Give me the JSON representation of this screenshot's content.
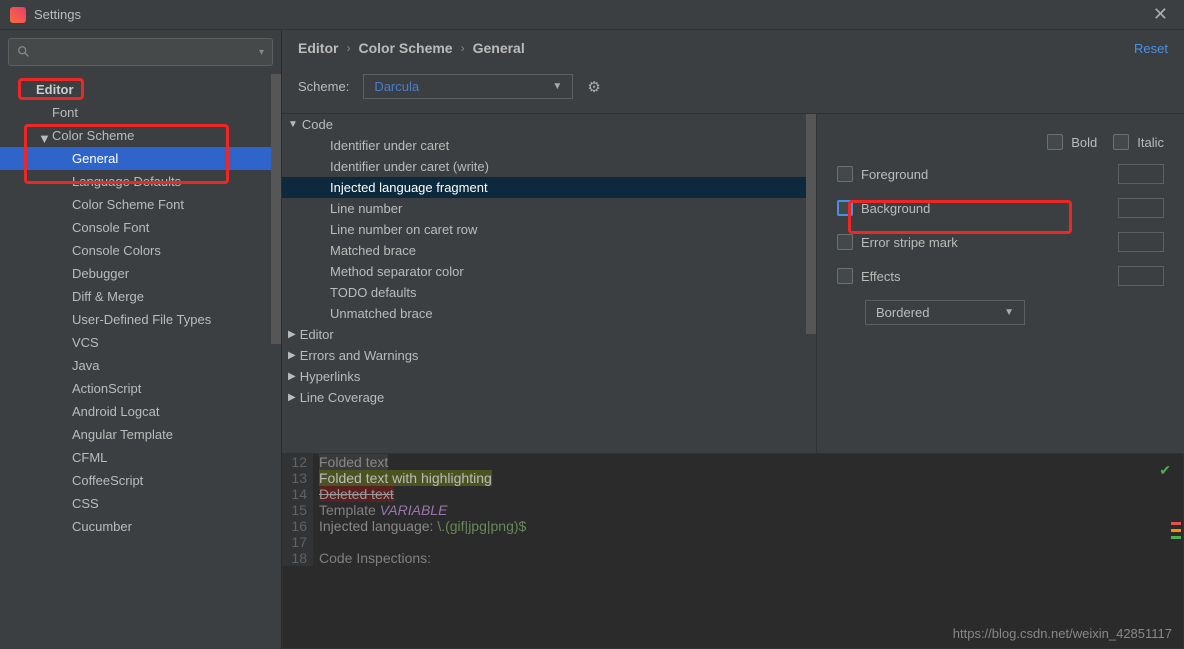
{
  "titlebar": {
    "title": "Settings",
    "search_placeholder": ""
  },
  "sidebar": {
    "editor_label": "Editor",
    "items": [
      {
        "label": "Font",
        "level": "l1"
      },
      {
        "label": "Color Scheme",
        "level": "l1",
        "expandable": true
      },
      {
        "label": "General",
        "level": "l2",
        "selected": true
      },
      {
        "label": "Language Defaults",
        "level": "l2"
      },
      {
        "label": "Color Scheme Font",
        "level": "l2"
      },
      {
        "label": "Console Font",
        "level": "l2"
      },
      {
        "label": "Console Colors",
        "level": "l2"
      },
      {
        "label": "Debugger",
        "level": "l2"
      },
      {
        "label": "Diff & Merge",
        "level": "l2"
      },
      {
        "label": "User-Defined File Types",
        "level": "l2"
      },
      {
        "label": "VCS",
        "level": "l2"
      },
      {
        "label": "Java",
        "level": "l2"
      },
      {
        "label": "ActionScript",
        "level": "l2"
      },
      {
        "label": "Android Logcat",
        "level": "l2"
      },
      {
        "label": "Angular Template",
        "level": "l2"
      },
      {
        "label": "CFML",
        "level": "l2"
      },
      {
        "label": "CoffeeScript",
        "level": "l2"
      },
      {
        "label": "CSS",
        "level": "l2"
      },
      {
        "label": "Cucumber",
        "level": "l2"
      }
    ]
  },
  "breadcrumb": {
    "a": "Editor",
    "b": "Color Scheme",
    "c": "General",
    "reset": "Reset"
  },
  "scheme": {
    "label": "Scheme:",
    "value": "Darcula"
  },
  "categories": {
    "code_label": "Code",
    "items": [
      "Identifier under caret",
      "Identifier under caret (write)",
      "Injected language fragment",
      "Line number",
      "Line number on caret row",
      "Matched brace",
      "Method separator color",
      "TODO defaults",
      "Unmatched brace"
    ],
    "groups": [
      "Editor",
      "Errors and Warnings",
      "Hyperlinks",
      "Line Coverage"
    ]
  },
  "props": {
    "bold": "Bold",
    "italic": "Italic",
    "foreground": "Foreground",
    "background": "Background",
    "error_stripe": "Error stripe mark",
    "effects": "Effects",
    "effects_value": "Bordered"
  },
  "preview": {
    "lines": [
      {
        "n": "12",
        "text": "Folded text",
        "cls": "folded"
      },
      {
        "n": "13",
        "text": "Folded text with highlighting",
        "cls": "folded-hl"
      },
      {
        "n": "14",
        "text": "Deleted text",
        "cls": "deleted"
      },
      {
        "n": "15",
        "html": true
      },
      {
        "n": "16",
        "html": true
      },
      {
        "n": "17",
        "text": ""
      },
      {
        "n": "18",
        "html": true
      }
    ],
    "template_kw": "Template ",
    "template_var": "VARIABLE",
    "injected_label": "Injected language: ",
    "injected_regex": "\\.(gif|jpg|png)$",
    "inspections": "Code Inspections:"
  },
  "watermark": "https://blog.csdn.net/weixin_42851117"
}
